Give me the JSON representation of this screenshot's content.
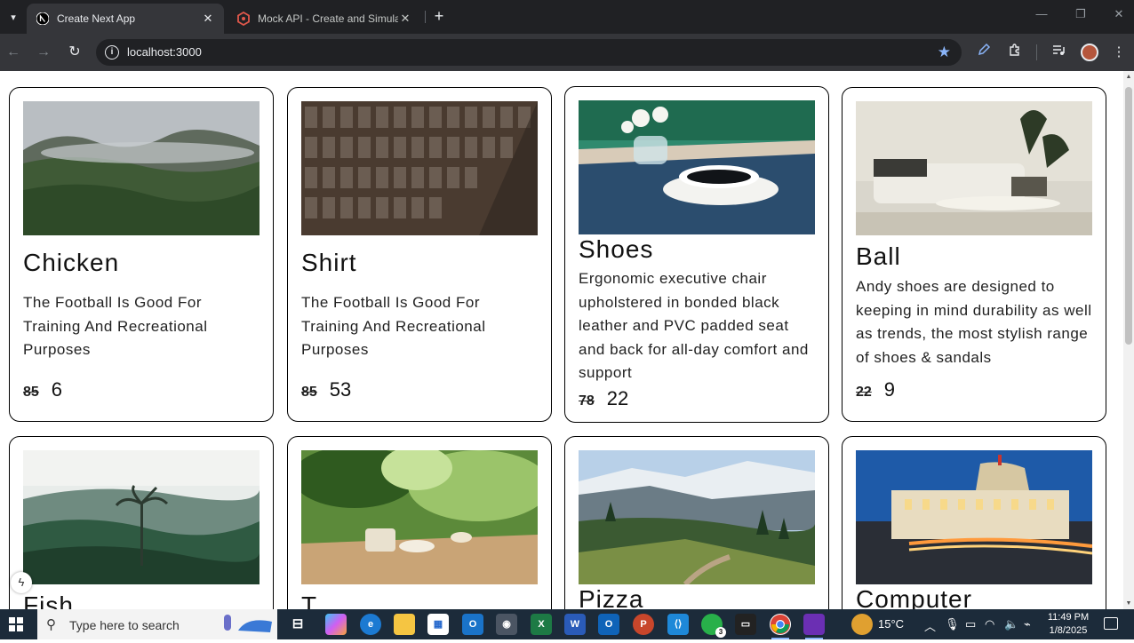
{
  "browser": {
    "tabs": [
      {
        "title": "Create Next App",
        "active": true,
        "icon": "nextjs-icon"
      },
      {
        "title": "Mock API - Create and Simulate",
        "active": false,
        "icon": "mockapi-icon"
      }
    ],
    "url": "localhost:3000"
  },
  "products": [
    {
      "title": "Chicken",
      "description": "The Football Is Good For Training And Recreational Purposes",
      "old_price": "85",
      "price": "6",
      "image": "misty-mountains"
    },
    {
      "title": "Shirt",
      "description": "The Football Is Good For Training And Recreational Purposes",
      "old_price": "85",
      "price": "53",
      "image": "building-facade"
    },
    {
      "title": "Shoes",
      "description": "Ergonomic executive chair upholstered in bonded black leather and PVC padded seat and back for all-day comfort and support",
      "old_price": "78",
      "price": "22",
      "image": "coffee-cup"
    },
    {
      "title": "Ball",
      "description": "Andy shoes are designed to keeping in mind durability as well as trends, the most stylish range of shoes & sandals",
      "old_price": "22",
      "price": "9",
      "image": "living-room"
    },
    {
      "title": "Fish",
      "image": "palm-forest"
    },
    {
      "title": "T",
      "image": "leaves-table"
    },
    {
      "title": "Pizza",
      "image": "alpine-valley"
    },
    {
      "title": "Computer",
      "image": "lit-building"
    }
  ],
  "taskbar": {
    "search_placeholder": "Type here to search",
    "weather": "15°C",
    "time": "11:49 PM",
    "date": "1/8/2025",
    "whatsapp_badge": "3"
  },
  "colors": {
    "chrome_dark": "#202124",
    "chrome_toolbar": "#35363a",
    "taskbar": "#1c2b3a",
    "accent": "#8ab4f8"
  }
}
